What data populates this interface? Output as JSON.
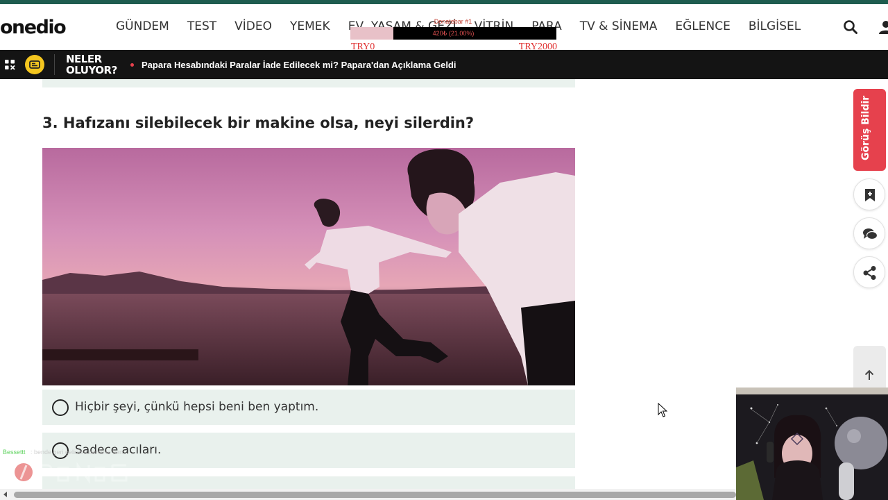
{
  "header": {
    "logo": "onedio",
    "nav": [
      "GÜNDEM",
      "TEST",
      "VİDEO",
      "YEMEK",
      "EV, YAŞAM & GEZİ",
      "VİTRİN",
      "PARA",
      "TV & SİNEMA",
      "EĞLENCE",
      "BİLGİSEL"
    ],
    "icons": [
      "search-icon",
      "user-icon"
    ]
  },
  "donation": {
    "title": "Donatebar #1",
    "percent_label": "420₺ (21.00%)",
    "progress": 0.21,
    "min_label": "TRY0",
    "max_label": "TRY2000"
  },
  "newsbar": {
    "title_line1": "NELER",
    "title_line2": "OLUYOR?",
    "headline": "Papara Hesabındaki Paralar İade Edilecek mi? Papara'dan Açıklama Geldi"
  },
  "quiz": {
    "question": "3. Hafızanı silebilecek bir makine olsa, neyi silerdin?",
    "answers": [
      "Hiçbir şeyi, çünkü hepsi beni ben yaptım.",
      "Sadece acıları."
    ]
  },
  "sidebar": {
    "feedback": "Görüş Bildir",
    "icons": [
      "bookmark-icon",
      "comments-icon",
      "share-icon",
      "arrow-up-icon"
    ]
  },
  "chat": {
    "user": "Bessettt",
    "message": ": bende geri gelirdim benimle ben"
  },
  "colors": {
    "accent": "#e6414d",
    "topbar": "#1f5c4f",
    "answer_bg": "#e9f1ed",
    "newsbar_bg": "#141414"
  }
}
